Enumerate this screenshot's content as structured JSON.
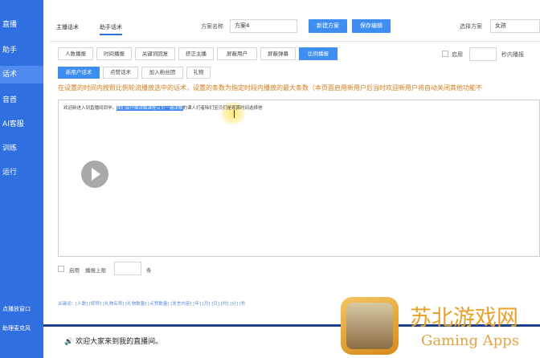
{
  "sidebar": {
    "items": [
      {
        "label": "直播"
      },
      {
        "label": "助手"
      },
      {
        "label": "话术"
      },
      {
        "label": "音首"
      },
      {
        "label": "AI客服"
      },
      {
        "label": "训练"
      },
      {
        "label": "运行"
      }
    ],
    "bottom_items": [
      {
        "label": "点播放窗口"
      },
      {
        "label": "助理麦克风"
      }
    ]
  },
  "header": {
    "tabs": [
      {
        "label": "主播话术"
      },
      {
        "label": "助手话术"
      }
    ],
    "plan_name_label": "方案名称",
    "plan_name_value": "方案4",
    "new_plan_button": "新建方案",
    "save_edit_button": "保存编辑",
    "select_plan_label": "选择方案",
    "select_plan_value": "女孩"
  },
  "sub_tabs": [
    {
      "label": "人数播报"
    },
    {
      "label": "时间播报"
    },
    {
      "label": "关键词回复"
    },
    {
      "label": "挤正主播"
    },
    {
      "label": "屏蔽用户"
    },
    {
      "label": "屏蔽弹幕"
    },
    {
      "label": "比例播报"
    }
  ],
  "right_controls": {
    "enable_label": "启用",
    "seconds_label": "秒内播报"
  },
  "inner_tabs": [
    {
      "label": "新用户话术"
    },
    {
      "label": "点赞话术"
    },
    {
      "label": "加入粉丝团"
    },
    {
      "label": "礼物"
    }
  ],
  "notice": "在设置的时间内按照比例轮流播放选中的话术，设置的条数为指定时段内播放的最大条数（本页面启用新用户后当时欢迎新用户将自动关闭其他功能不",
  "editor": {
    "text_before": "欢迎新进入到直播间同学。",
    "text_selected": "我们会仔细讲解课程认识一遍讲解",
    "text_after": "的课人们者除们宝贝们是观算时间选择他"
  },
  "bottom_controls": {
    "enable_label": "启用",
    "limit_label": "播报上限",
    "unit_label": "条"
  },
  "keywords": "关键词：[人数] [昵称] [礼物名称] [礼物数量] [点赞数量] [发言内容] [年] [月] [日] [时] [分] [秒",
  "chat": {
    "message": "欢迎大家来到我的直播间。"
  },
  "watermark": {
    "title": "苏北游戏网",
    "subtitle": "Gaming Apps"
  }
}
